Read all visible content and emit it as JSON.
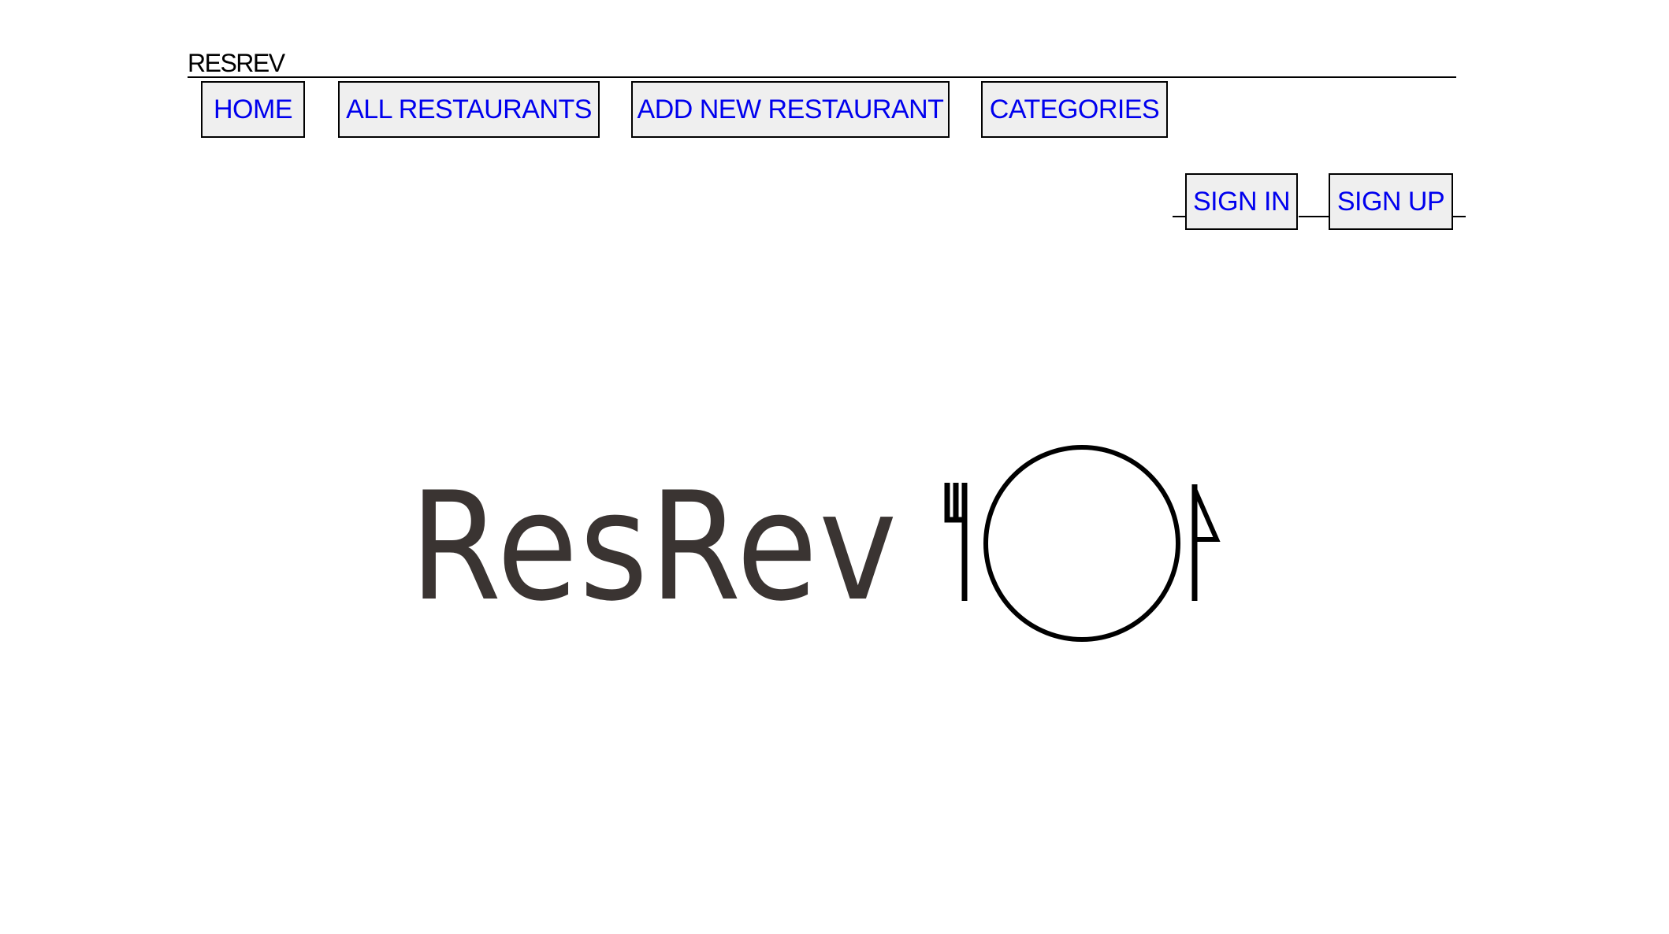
{
  "header": {
    "site_title": "RESREV"
  },
  "nav": {
    "items": [
      {
        "label": "HOME"
      },
      {
        "label": "ALL RESTAURANTS"
      },
      {
        "label": "ADD NEW RESTAURANT"
      },
      {
        "label": "CATEGORIES"
      }
    ]
  },
  "auth": {
    "sign_in_label": "SIGN IN",
    "sign_up_label": "SIGN UP"
  },
  "logo": {
    "wordmark": "ResRev",
    "icon": "fork-plate-knife-icon",
    "text_color": "#3a3432",
    "icon_color": "#000000"
  },
  "colors": {
    "link": "#0000ee",
    "button_bg": "#efefef",
    "border": "#000000"
  }
}
